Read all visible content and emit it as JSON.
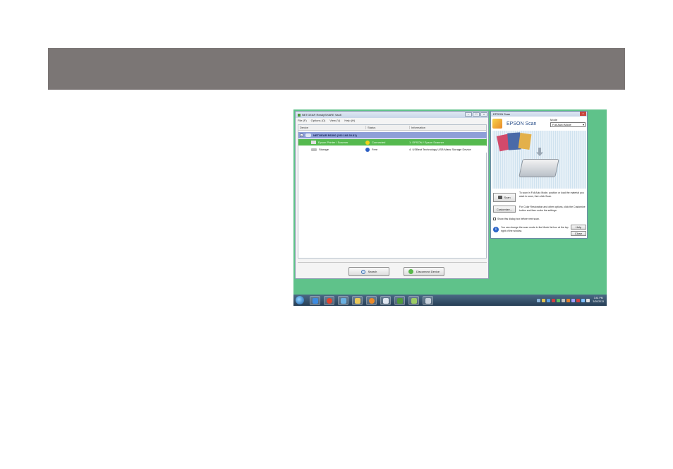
{
  "netgear_window": {
    "title": "NETGEAR ReadySHARE Vault",
    "minimize": "–",
    "maximize": "□",
    "close": "×",
    "menu": [
      "File (F)",
      "Options (O)",
      "View (V)",
      "Help (H)"
    ],
    "columns": [
      "Device",
      "Status",
      "Information"
    ],
    "group": {
      "expander": "−",
      "label": "NETGEAR R6300 (192.168.30.81)"
    },
    "rows": [
      {
        "device": "Epson Printer / Scanner",
        "status": "Connected",
        "info": "1: EPSON / Epson Scanner"
      },
      {
        "device": "Storage",
        "status": "Free",
        "info": "4: USBest Technology USB Mass Storage Device"
      }
    ],
    "search_button": "Search",
    "disconnect_button": "Disconnect Device"
  },
  "epson_window": {
    "title": "EPSON Scan",
    "close": "×",
    "brand": "EPSON Scan",
    "mode_label": "Mode",
    "mode_value": "Full Auto Mode",
    "scan_button": "Scan",
    "scan_desc": "To scan in Full Auto Mode, position or load the material you want to scan, then click Scan.",
    "customize_button": "Customize...",
    "customize_desc": "For Color Restoration and other options, click the Customize button and then make the settings.",
    "show_dialog": "Show this dialog box before next scan.",
    "info_text": "You can change the scan mode in the Mode list box at the top right of the window.",
    "help_button": "Help",
    "close_button": "Close"
  },
  "taskbar": {
    "clock_time": "3:41 PM",
    "clock_date": "3/20/2013"
  },
  "colors": {
    "header_band": "#7b7675",
    "desktop": "#5fc28a",
    "selected_row": "#55b94e",
    "group_row": "#8e9fd8"
  }
}
